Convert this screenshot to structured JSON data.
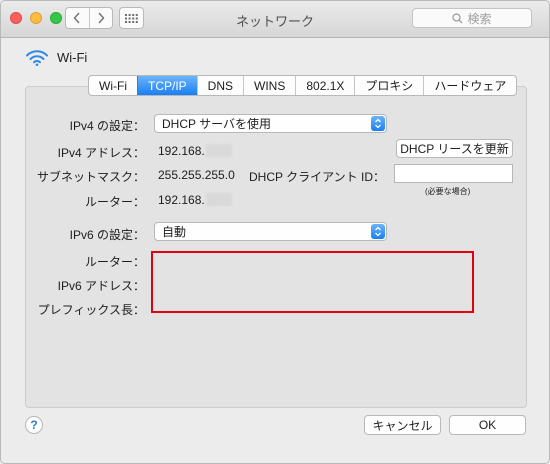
{
  "window": {
    "title": "ネットワーク"
  },
  "toolbar": {
    "back_icon": "chevron-left-icon",
    "forward_icon": "chevron-right-icon",
    "show_all_icon": "grid-icon",
    "search_placeholder": "検索"
  },
  "interface": {
    "name": "Wi-Fi",
    "icon": "wifi-icon"
  },
  "tabs": [
    {
      "label": "Wi-Fi",
      "active": false
    },
    {
      "label": "TCP/IP",
      "active": true
    },
    {
      "label": "DNS",
      "active": false
    },
    {
      "label": "WINS",
      "active": false
    },
    {
      "label": "802.1X",
      "active": false
    },
    {
      "label": "プロキシ",
      "active": false
    },
    {
      "label": "ハードウェア",
      "active": false
    }
  ],
  "ipv4": {
    "configure_label": "IPv4 の設定：",
    "configure_value": "DHCP サーバを使用",
    "address_label": "IPv4 アドレス：",
    "address_value": "192.168.",
    "subnet_label": "サブネットマスク：",
    "subnet_value": "255.255.255.0",
    "router_label": "ルーター：",
    "router_value": "192.168.",
    "renew_button": "DHCP リースを更新",
    "client_id_label": "DHCP クライアント ID：",
    "client_id_value": "",
    "client_id_note": "(必要な場合)"
  },
  "ipv6": {
    "configure_label": "IPv6 の設定：",
    "configure_value": "自動",
    "router_label": "ルーター：",
    "address_label": "IPv6 アドレス：",
    "prefix_label": "プレフィックス長："
  },
  "footer": {
    "help_label": "?",
    "cancel_button": "キャンセル",
    "ok_button": "OK"
  },
  "colors": {
    "accent": "#1a7ff4",
    "highlight_border": "#e3000f"
  }
}
